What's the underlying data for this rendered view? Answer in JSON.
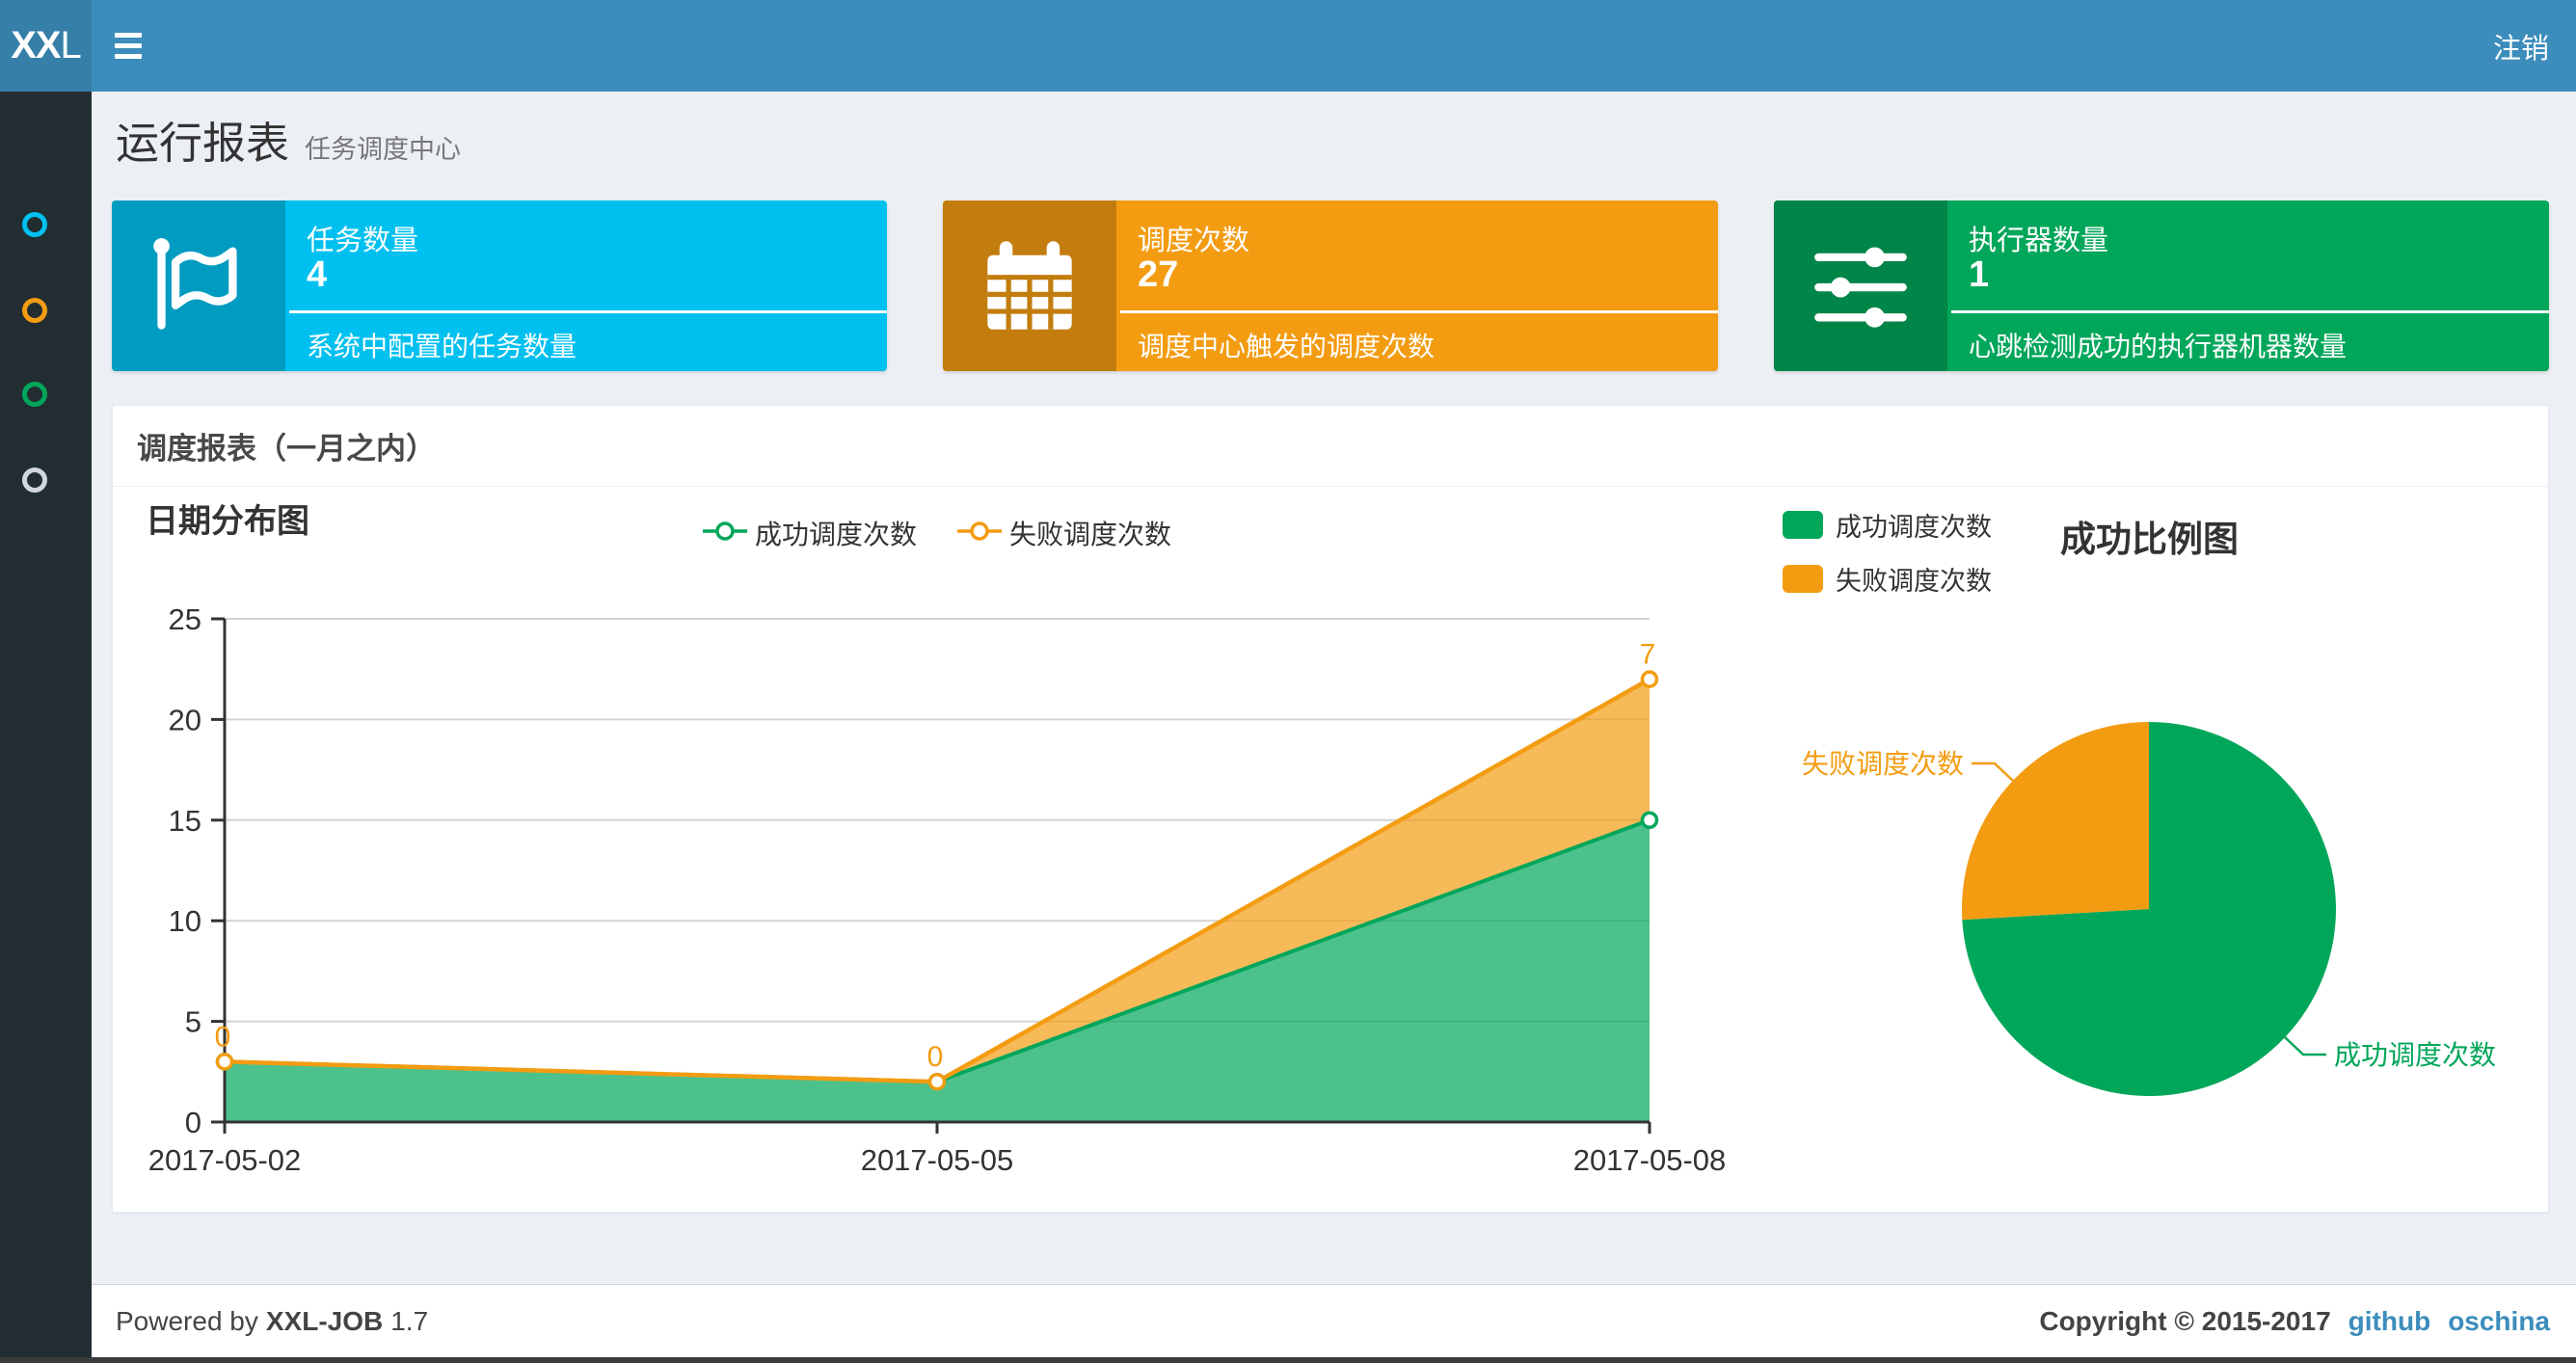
{
  "theme": {
    "navbar_bg": "#3c8dbc",
    "logo_bg": "#367fa9",
    "sidebar_bg": "#222d32",
    "content_bg": "#ecf0f5",
    "link_color": "#3c8dbc"
  },
  "navbar": {
    "logo_bold": "XX",
    "logo_light": "L",
    "logout_label": "注销"
  },
  "sidebar": {
    "items": [
      {
        "icon": "circle-o-icon",
        "color": "#00c0ef"
      },
      {
        "icon": "circle-o-icon",
        "color": "#f39c12"
      },
      {
        "icon": "circle-o-icon",
        "color": "#00a65a"
      },
      {
        "icon": "circle-o-icon",
        "color": "#d2d6de"
      }
    ]
  },
  "header": {
    "title": "运行报表",
    "subtitle": "任务调度中心"
  },
  "stat_cards": [
    {
      "title": "任务数量",
      "value": "4",
      "desc": "系统中配置的任务数量",
      "bg": "#00c0ef",
      "icon_bg": "#009bc1",
      "icon": "flag-icon"
    },
    {
      "title": "调度次数",
      "value": "27",
      "desc": "调度中心触发的调度次数",
      "bg": "#f39c12",
      "icon_bg": "#c27d0e",
      "icon": "calendar-icon"
    },
    {
      "title": "执行器数量",
      "value": "1",
      "desc": "心跳检测成功的执行器机器数量",
      "bg": "#00a65a",
      "icon_bg": "#008548",
      "icon": "sliders-icon"
    }
  ],
  "panel": {
    "title": "调度报表（一月之内）"
  },
  "chart_data": [
    {
      "type": "area",
      "stacked": true,
      "title": "日期分布图",
      "categories": [
        "2017-05-02",
        "2017-05-05",
        "2017-05-08"
      ],
      "series": [
        {
          "name": "成功调度次数",
          "color": "#00A65A",
          "values": [
            3,
            2,
            15
          ]
        },
        {
          "name": "失败调度次数",
          "color": "#F39C12",
          "values": [
            0,
            0,
            7
          ]
        }
      ],
      "point_labels": [
        "0",
        "0",
        "7"
      ],
      "xlabel": "",
      "ylabel": "",
      "ylim": [
        0,
        25
      ],
      "yticks": [
        0,
        5,
        10,
        15,
        20,
        25
      ],
      "grid": true,
      "legend_position": "top-center"
    },
    {
      "type": "pie",
      "title": "成功比例图",
      "slices": [
        {
          "label": "成功调度次数",
          "value": 20,
          "color": "#00A65A"
        },
        {
          "label": "失败调度次数",
          "value": 7,
          "color": "#F39C12"
        }
      ],
      "start_angle": "top",
      "direction": "clockwise",
      "legend_position": "top-left"
    }
  ],
  "footer": {
    "powered_prefix": "Powered by",
    "product": "XXL-JOB",
    "version": "1.7",
    "copyright": "Copyright © 2015-2017",
    "links": [
      {
        "label": "github"
      },
      {
        "label": "oschina"
      }
    ]
  }
}
